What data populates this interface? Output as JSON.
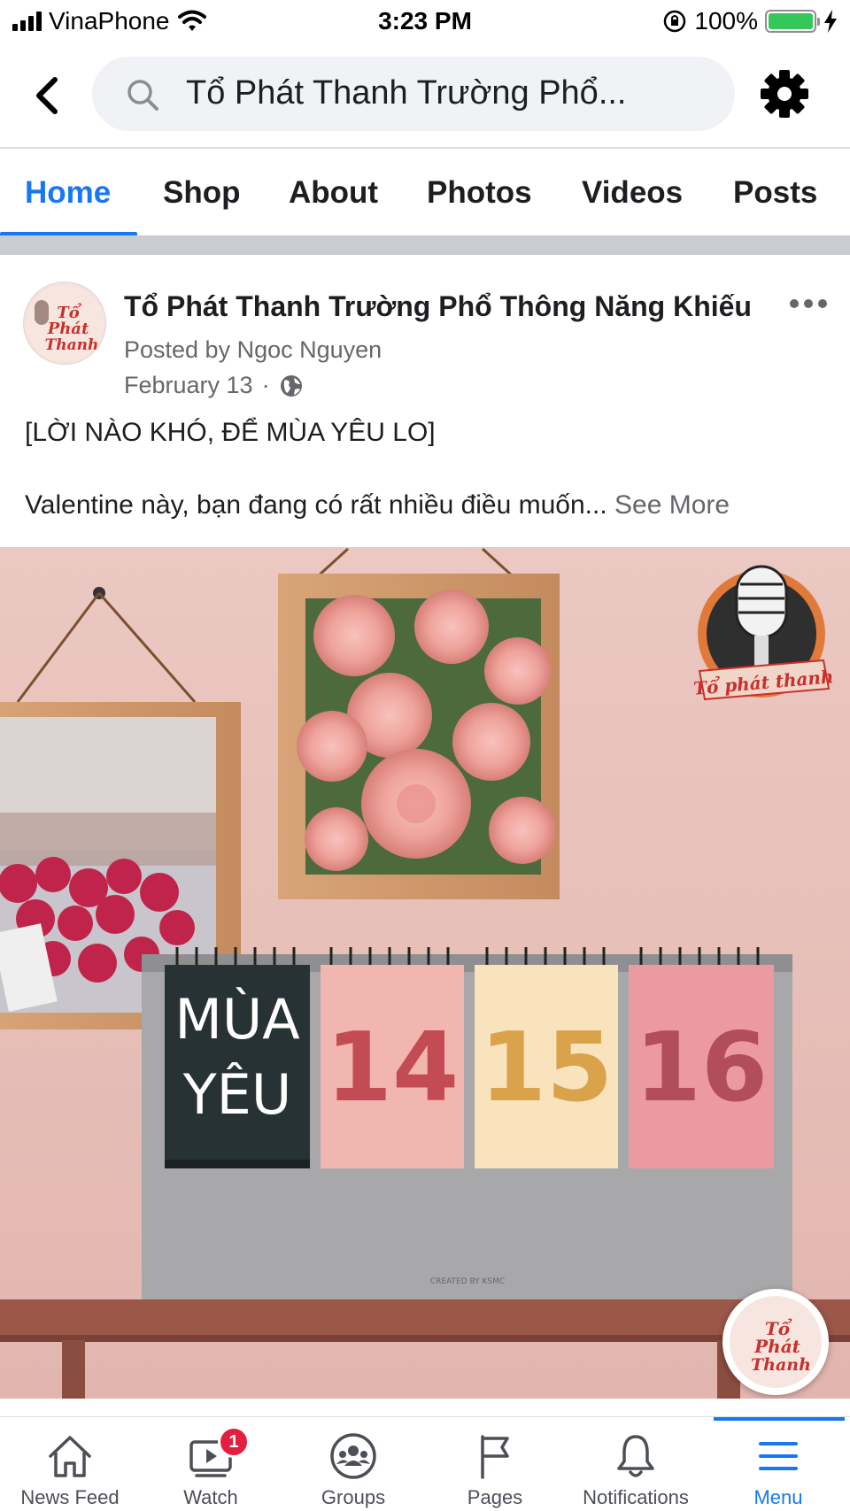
{
  "status_bar": {
    "carrier": "VinaPhone",
    "time": "3:23 PM",
    "battery_percent": "100%",
    "battery_level": 1.0
  },
  "search": {
    "query": "Tổ Phát Thanh Trường Phổ..."
  },
  "tabs": [
    {
      "label": "Home",
      "active": true
    },
    {
      "label": "Shop"
    },
    {
      "label": "About"
    },
    {
      "label": "Photos"
    },
    {
      "label": "Videos"
    },
    {
      "label": "Posts"
    }
  ],
  "post": {
    "page_name": "Tổ Phát Thanh Trường Phổ Thông Năng Khiếu",
    "posted_by": "Posted by Ngoc Nguyen",
    "date": "February 13",
    "separator": "·",
    "headline": "[LỜI NÀO KHÓ, ĐỂ MÙA YÊU LO]",
    "body": "Valentine này, bạn đang có rất nhiều điều muốn...",
    "see_more": "See More",
    "image": {
      "calendar_cards": [
        "MÙA",
        "YÊU",
        "14",
        "15",
        "16"
      ],
      "logo_text": "Tổ phát thanh",
      "avatar_text": "Tổ Phát Thanh",
      "small_print": "CREATED BY KSMC"
    }
  },
  "bottom_nav": [
    {
      "label": "News Feed",
      "icon": "home-icon"
    },
    {
      "label": "Watch",
      "icon": "watch-icon",
      "badge": "1"
    },
    {
      "label": "Groups",
      "icon": "groups-icon"
    },
    {
      "label": "Pages",
      "icon": "pages-flag-icon"
    },
    {
      "label": "Notifications",
      "icon": "bell-icon"
    },
    {
      "label": "Menu",
      "icon": "menu-icon",
      "active": true
    }
  ],
  "colors": {
    "accent": "#1877f2",
    "badge": "#e41e3f",
    "battery": "#34c759"
  }
}
